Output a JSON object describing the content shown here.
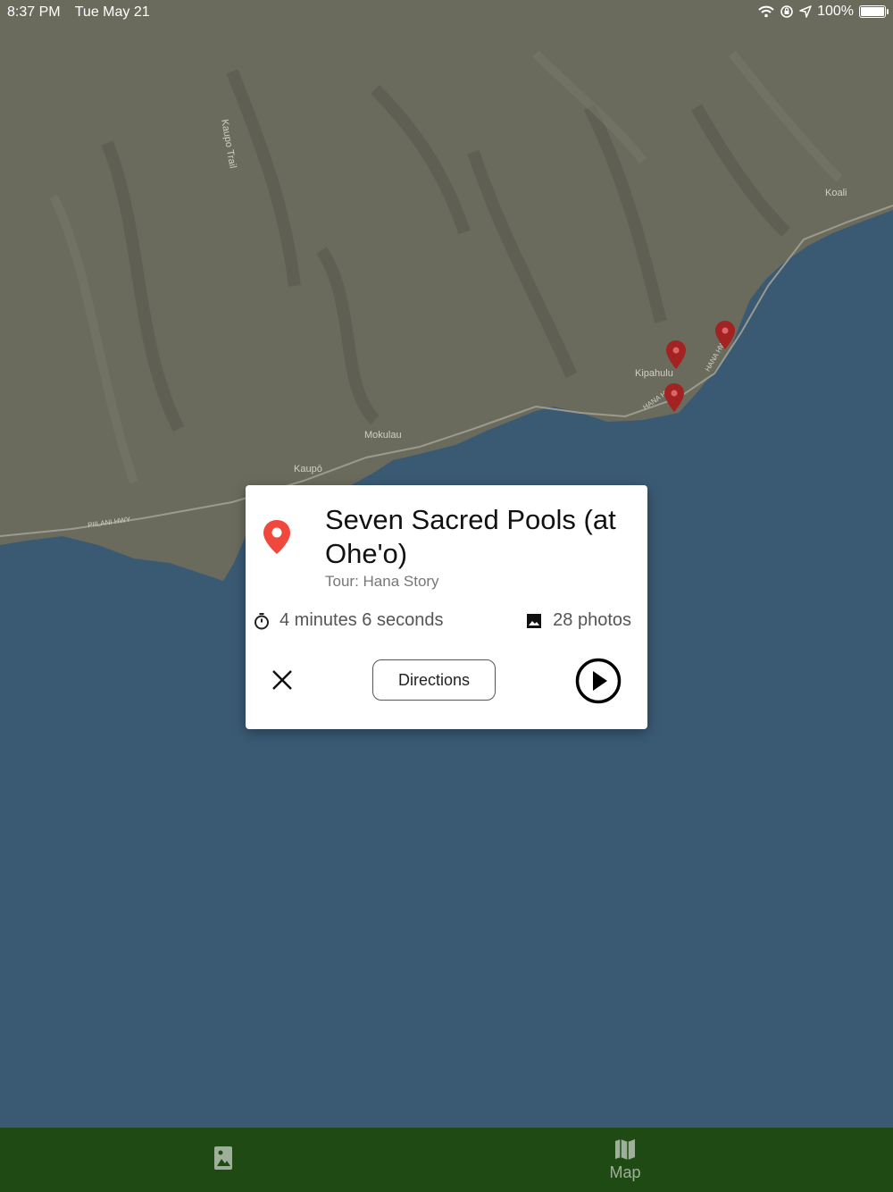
{
  "status_bar": {
    "time": "8:37 PM",
    "date": "Tue May 21",
    "battery": "100%",
    "icons": [
      "wifi-icon",
      "orientation-lock-icon",
      "location-arrow-icon",
      "battery-icon"
    ]
  },
  "map": {
    "labels": {
      "kaupo_trail": "Kaupo Trail",
      "koali": "Koali",
      "kipahulu": "Kipahulu",
      "mokulau": "Mokulau",
      "kaupo": "Kaupō",
      "piilani_hwy": "PIILANI HWY",
      "hana_hwy_1": "HANA HWY",
      "hana_hwy_2": "HANA HWY"
    },
    "colors": {
      "ocean": "#3a5a74",
      "land": "#6a6a5c",
      "pin": "#a32222"
    },
    "pin_count": 3
  },
  "card": {
    "title": "Seven Sacred Pools (at Ohe'o)",
    "tour": "Tour: Hana Story",
    "duration": "4 minutes 6 seconds",
    "photos": "28 photos",
    "directions_label": "Directions",
    "pin_color": "#f0483c"
  },
  "tabbar": {
    "tabs": [
      {
        "icon": "photo-portrait-icon",
        "label": ""
      },
      {
        "icon": "map-icon",
        "label": "Map"
      }
    ],
    "background": "#1f4a14"
  }
}
